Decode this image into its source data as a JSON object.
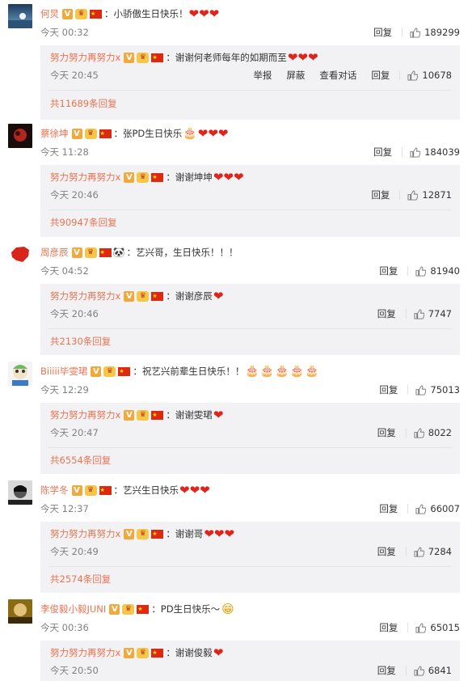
{
  "actions": {
    "reply": "回复",
    "report": "举报",
    "block": "屏蔽",
    "view_conversation": "查看对话"
  },
  "comments": [
    {
      "user": "何炅",
      "text": "：小骄傲生日快乐！",
      "time": "今天 00:32",
      "likes": "189299",
      "reply": {
        "user": "努力努力再努力x",
        "text": "：谢谢何老师每年的如期而至",
        "time": "今天 20:45",
        "likes": "10678"
      },
      "reply_count": "共11689条回复"
    },
    {
      "user": "蔡徐坤",
      "text": "：张PD生日快乐",
      "time": "今天 11:28",
      "likes": "184039",
      "reply": {
        "user": "努力努力再努力x",
        "text": "：谢谢坤坤",
        "time": "今天 20:46",
        "likes": "12871"
      },
      "reply_count": "共90947条回复"
    },
    {
      "user": "周彦辰",
      "text": "：艺兴哥，生日快乐！！！",
      "time": "今天 04:52",
      "likes": "81940",
      "reply": {
        "user": "努力努力再努力x",
        "text": "：谢谢彦辰",
        "time": "今天 20:46",
        "likes": "7747"
      },
      "reply_count": "共2130条回复"
    },
    {
      "user": "Biiiii毕雯珺",
      "text": "：祝艺兴前辈生日快乐！！",
      "time": "今天 12:29",
      "likes": "75013",
      "reply": {
        "user": "努力努力再努力x",
        "text": "：谢谢雯珺",
        "time": "今天 20:47",
        "likes": "8022"
      },
      "reply_count": "共6554条回复"
    },
    {
      "user": "陈学冬",
      "text": "：艺兴生日快乐",
      "time": "今天 12:37",
      "likes": "66007",
      "reply": {
        "user": "努力努力再努力x",
        "text": "：谢谢哥",
        "time": "今天 20:49",
        "likes": "7284"
      },
      "reply_count": "共2574条回复"
    },
    {
      "user": "李俊毅小毅JUNI",
      "text": "：PD生日快乐～",
      "time": "今天 00:36",
      "likes": "65015",
      "reply": {
        "user": "努力努力再努力x",
        "text": "：谢谢俊毅",
        "time": "今天 20:50",
        "likes": "6841"
      }
    }
  ],
  "badges": {
    "verified": "V",
    "crown": "♛",
    "flag": "★"
  },
  "emoji": {
    "heart": "❤",
    "cake": "🎂",
    "panda": "🐼",
    "grin": "😁"
  },
  "colors": {
    "username": "#eb7350",
    "reply_bg": "#f2f2f5",
    "heart": "#e0241b"
  }
}
